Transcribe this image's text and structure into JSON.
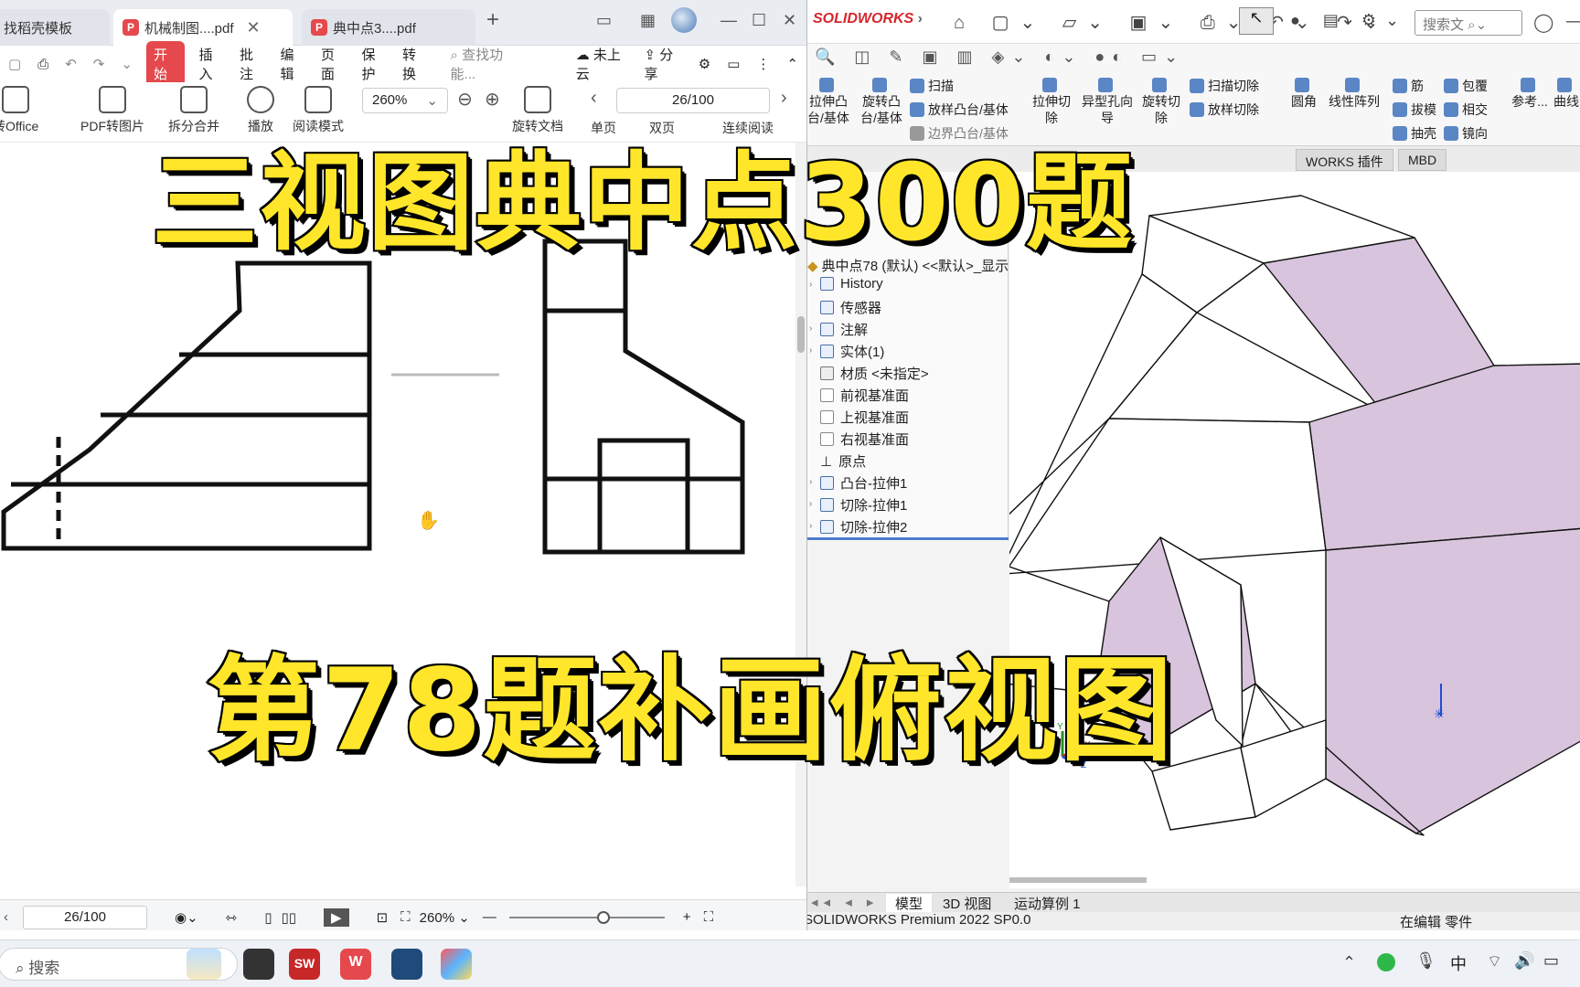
{
  "pdf": {
    "tabs": [
      {
        "label": "找稻壳模板"
      },
      {
        "label": "机械制图....pdf"
      },
      {
        "label": "典中点3....pdf"
      }
    ],
    "menu": [
      "开始",
      "插入",
      "批注",
      "编辑",
      "页面",
      "保护",
      "转换"
    ],
    "search_placeholder": "查找功能...",
    "cloud_label": "未上云",
    "share_label": "分享",
    "ribbon": {
      "to_office": "转Office",
      "pdf_to_img": "PDF转图片",
      "split_merge": "拆分合并",
      "play": "播放",
      "read_mode": "阅读模式",
      "rotate": "旋转文档",
      "single": "单页",
      "double": "双页",
      "continuous": "连续阅读"
    },
    "zoom": "260%",
    "page_indicator": "26/100",
    "status": {
      "page": "26/100",
      "zoom": "260%"
    }
  },
  "sw": {
    "logo": "SOLIDWORKS",
    "search_placeholder": "搜索文",
    "ribbon": {
      "extrude_boss": "拉伸凸台/基体",
      "revolve_boss": "旋转凸台/基体",
      "sweep": "扫描",
      "loft_boss": "放样凸台/基体",
      "boundary_boss": "边界凸台/基体",
      "extrude_cut": "拉伸切除",
      "hole_wizard": "异型孔向导",
      "revolve_cut": "旋转切除",
      "sweep_cut": "扫描切除",
      "loft_cut": "放样切除",
      "fillet": "圆角",
      "linear_pattern": "线性阵列",
      "rib": "筋",
      "draft": "拔模",
      "shell": "抽壳",
      "wrap": "包覆",
      "intersect": "相交",
      "mirror": "镜向",
      "ref": "参考...",
      "curves": "曲线"
    },
    "tabs2": [
      "WORKS 插件",
      "MBD"
    ],
    "tree": {
      "root": "典中点78 (默认) <<默认>_显示",
      "items": [
        "History",
        "传感器",
        "注解",
        "实体(1)",
        "材质 <未指定>",
        "前视基准面",
        "上视基准面",
        "右视基准面",
        "原点",
        "凸台-拉伸1",
        "切除-拉伸1",
        "切除-拉伸2"
      ]
    },
    "bottom_tabs": [
      "模型",
      "3D 视图",
      "运动算例 1"
    ],
    "status_left": "SOLIDWORKS Premium 2022 SP0.0",
    "status_right": "在编辑 零件",
    "axes": {
      "x": "X",
      "y": "Y",
      "z": "Z"
    }
  },
  "taskbar": {
    "search": "搜索",
    "ime": "中"
  },
  "overlay": {
    "title": "三视图典中点300题",
    "subtitle": "第78题补画俯视图"
  }
}
